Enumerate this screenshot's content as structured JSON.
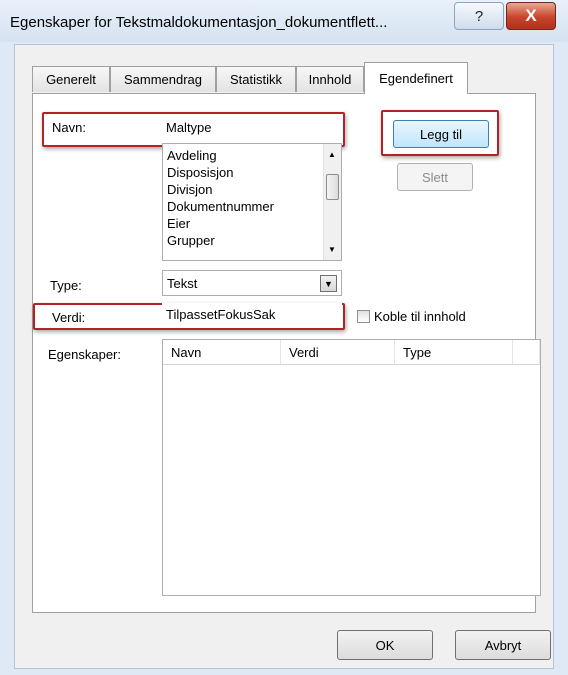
{
  "window": {
    "title": "Egenskaper for Tekstmaldokumentasjon_dokumentflett...",
    "help_glyph": "?",
    "close_glyph": "X"
  },
  "tabs": [
    {
      "label": "Generelt",
      "active": false
    },
    {
      "label": "Sammendrag",
      "active": false
    },
    {
      "label": "Statistikk",
      "active": false
    },
    {
      "label": "Innhold",
      "active": false
    },
    {
      "label": "Egendefinert",
      "active": true
    }
  ],
  "form": {
    "name_label": "Navn:",
    "name_value": "Maltype",
    "name_list": [
      "Avdeling",
      "Disposisjon",
      "Divisjon",
      "Dokumentnummer",
      "Eier",
      "Grupper"
    ],
    "type_label": "Type:",
    "type_value": "Tekst",
    "value_label": "Verdi:",
    "value_value": "TilpassetFokusSak",
    "link_checkbox_label": "Koble til innhold",
    "link_checked": false,
    "add_button": "Legg til",
    "delete_button": "Slett",
    "properties_label": "Egenskaper:",
    "properties_columns": [
      "Navn",
      "Verdi",
      "Type"
    ]
  },
  "footer": {
    "ok_button": "OK",
    "cancel_button": "Avbryt"
  },
  "colors": {
    "highlight_border": "#b22226",
    "title_bar": "#dfe9f5",
    "close_button": "#c8442a"
  }
}
